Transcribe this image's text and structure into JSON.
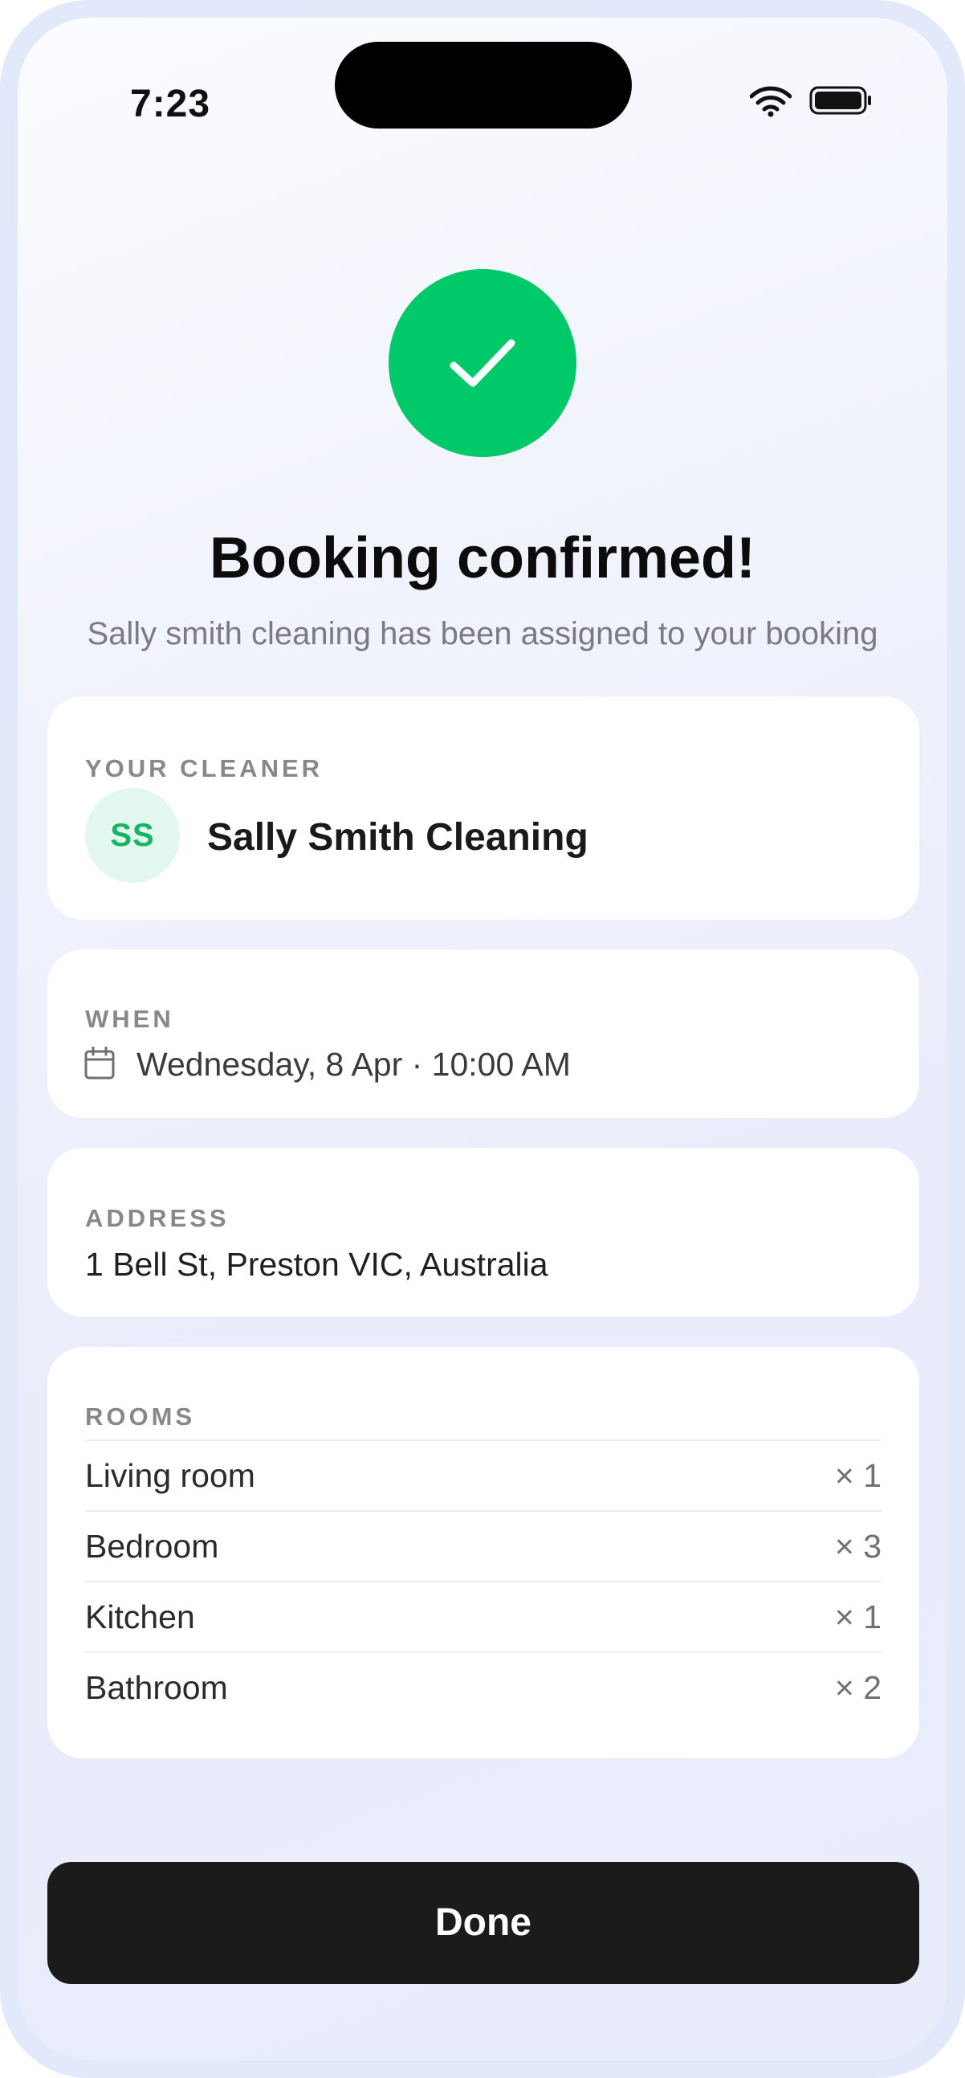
{
  "status_bar": {
    "time": "7:23",
    "wifi_icon": "wifi-icon",
    "battery_icon": "battery-icon"
  },
  "confirmation": {
    "icon": "checkmark-icon",
    "icon_color": "#00c96a",
    "title": "Booking confirmed!",
    "subtitle": "Sally smith cleaning has been assigned to your booking"
  },
  "cleaner": {
    "label": "YOUR CLEANER",
    "initials": "SS",
    "name": "Sally Smith Cleaning",
    "avatar_bg": "#e2f7ed",
    "avatar_fg": "#16b463"
  },
  "when": {
    "label": "WHEN",
    "icon": "calendar-icon",
    "value": "Wednesday, 8 Apr · 10:00 AM"
  },
  "address": {
    "label": "ADDRESS",
    "value": "1 Bell St, Preston VIC, Australia"
  },
  "rooms": {
    "label": "ROOMS",
    "items": [
      {
        "name": "Living room",
        "qty": "× 1"
      },
      {
        "name": "Bedroom",
        "qty": "× 3"
      },
      {
        "name": "Kitchen",
        "qty": "× 1"
      },
      {
        "name": "Bathroom",
        "qty": "× 2"
      }
    ]
  },
  "actions": {
    "done_label": "Done"
  }
}
